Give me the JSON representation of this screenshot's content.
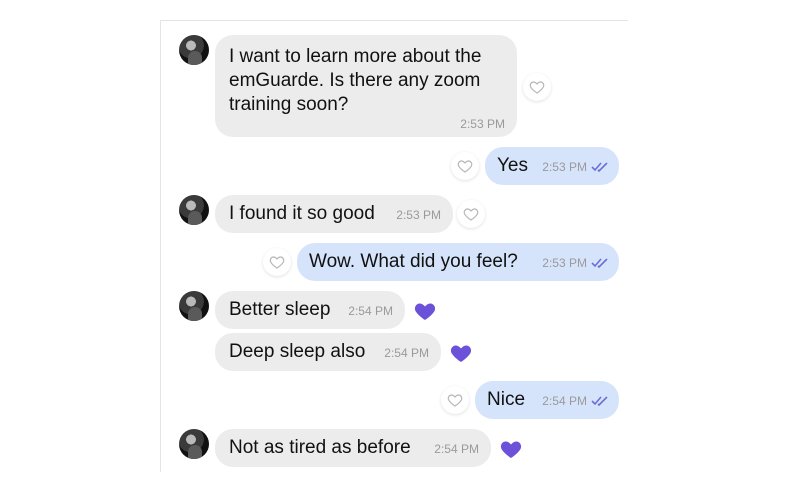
{
  "messages": [
    {
      "text_lines": [
        "I want to learn more about the",
        "emGuarde. Is there any zoom",
        "training soon?"
      ],
      "time": "2:53 PM"
    },
    {
      "text": "Yes",
      "time": "2:53 PM"
    },
    {
      "text": "I found it so good",
      "time": "2:53 PM"
    },
    {
      "text": "Wow. What did you feel?",
      "time": "2:53 PM"
    },
    {
      "text": "Better sleep",
      "time": "2:54 PM"
    },
    {
      "text": "Deep sleep also",
      "time": "2:54 PM"
    },
    {
      "text": "Nice",
      "time": "2:54 PM"
    },
    {
      "text": "Not as tired as before",
      "time": "2:54 PM"
    }
  ],
  "colors": {
    "incoming_bubble": "#ececec",
    "outgoing_bubble": "#d6e4fb",
    "liked_heart": "#6b52d8",
    "read_ticks": "#6b6fd6"
  },
  "icons": {
    "avatar": "avatar",
    "like_empty": "heart-outline-icon",
    "like_filled": "heart-filled-icon",
    "read": "double-check-icon"
  }
}
